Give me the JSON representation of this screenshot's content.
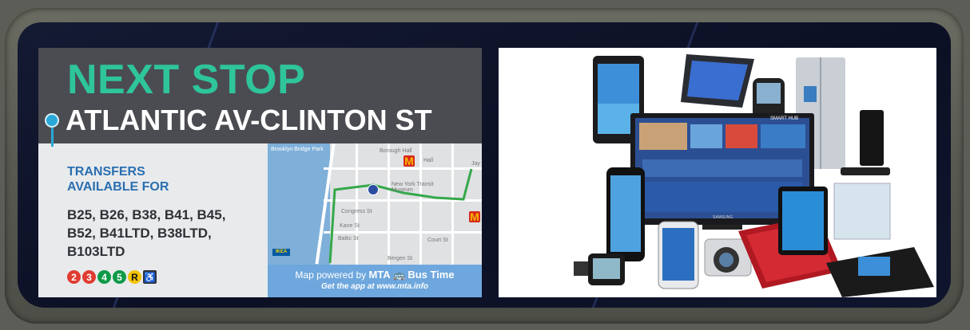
{
  "sign": {
    "next_stop_label": "NEXT STOP",
    "stop_name": "ATLANTIC AV-CLINTON ST",
    "transfers_label_line1": "TRANSFERS",
    "transfers_label_line2": "AVAILABLE FOR",
    "routes_line1": "B25, B26, B38, B41, B45,",
    "routes_line2": "B52, B41LTD, B38LTD,",
    "routes_line3": "B103LTD",
    "subway_lines": [
      "2",
      "3",
      "4",
      "5",
      "R"
    ],
    "accessible_icon": "wheelchair-icon",
    "colors": {
      "next_stop": "#2ec59a",
      "header_bg": "#4b4c51",
      "transfers": "#2a6fb0",
      "line_2_3": "#e03c31",
      "line_4_5": "#0f9a48",
      "line_R": "#f4c300"
    }
  },
  "map": {
    "powered_by": "Map powered by",
    "brand": "MTA",
    "brand2": "Bus Time",
    "get_app": "Get the app at www.mta.info",
    "labels": [
      "Borough Hall",
      "Hall",
      "New York Transit Museum",
      "Congress St",
      "Kane St",
      "Baltic St",
      "Bergen St",
      "Court St",
      "Jay",
      "Brooklyn Bridge Park"
    ],
    "ikea_label": "IKEA"
  },
  "ad": {
    "description_icon": "electronics-collage-icon",
    "tv_brand": "SAMSUNG",
    "tv_hub": "SMART HUB"
  }
}
